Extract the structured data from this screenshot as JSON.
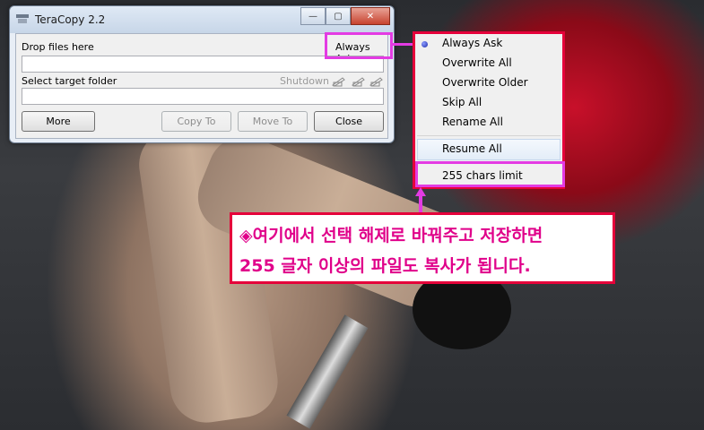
{
  "window": {
    "title": "TeraCopy 2.2",
    "controls": [
      "minimize",
      "maximize",
      "close"
    ]
  },
  "panel": {
    "source_label": "Drop files here",
    "overwrite_mode": "Always Ask",
    "source_value": "",
    "target_label": "Select target folder",
    "shutdown_label": "Shutdown",
    "target_value": ""
  },
  "buttons": {
    "more": "More",
    "copy_to": "Copy To",
    "move_to": "Move To",
    "close": "Close"
  },
  "menu": {
    "items": [
      "Always Ask",
      "Overwrite All",
      "Overwrite Older",
      "Skip All",
      "Rename All"
    ],
    "selected": "Always Ask",
    "resume": "Resume All",
    "limit": "255 chars limit"
  },
  "note": {
    "line1": "◈여기에서 선택 해제로 바꿔주고 저장하면",
    "line2": "255 글자 이상의 파일도 복사가 됩니다."
  },
  "colors": {
    "highlight": "#e33be3",
    "menu_border": "#e5003a",
    "note_text": "#e0008a"
  }
}
